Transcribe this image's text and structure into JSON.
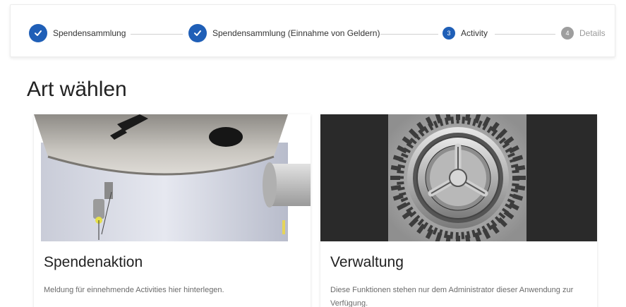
{
  "stepper": {
    "steps": [
      {
        "label": "Spendensammlung",
        "state": "done"
      },
      {
        "label": "Spendensammlung (Einnahme von Geldern)",
        "state": "done"
      },
      {
        "label": "Activity",
        "number": "3",
        "state": "active"
      },
      {
        "label": "Details",
        "number": "4",
        "state": "pending"
      }
    ]
  },
  "page": {
    "title": "Art wählen"
  },
  "cards": [
    {
      "title": "Spendenaktion",
      "description": "Meldung für einnehmende Activities hier hinterlegen.",
      "image": "donation-box-image"
    },
    {
      "title": "Verwaltung",
      "description": "Diese Funktionen stehen nur dem Administrator dieser Anwendung zur Verfügung.",
      "image": "gear-image"
    }
  ],
  "colors": {
    "accent": "#1f5fb7",
    "pending": "#9e9e9e"
  }
}
